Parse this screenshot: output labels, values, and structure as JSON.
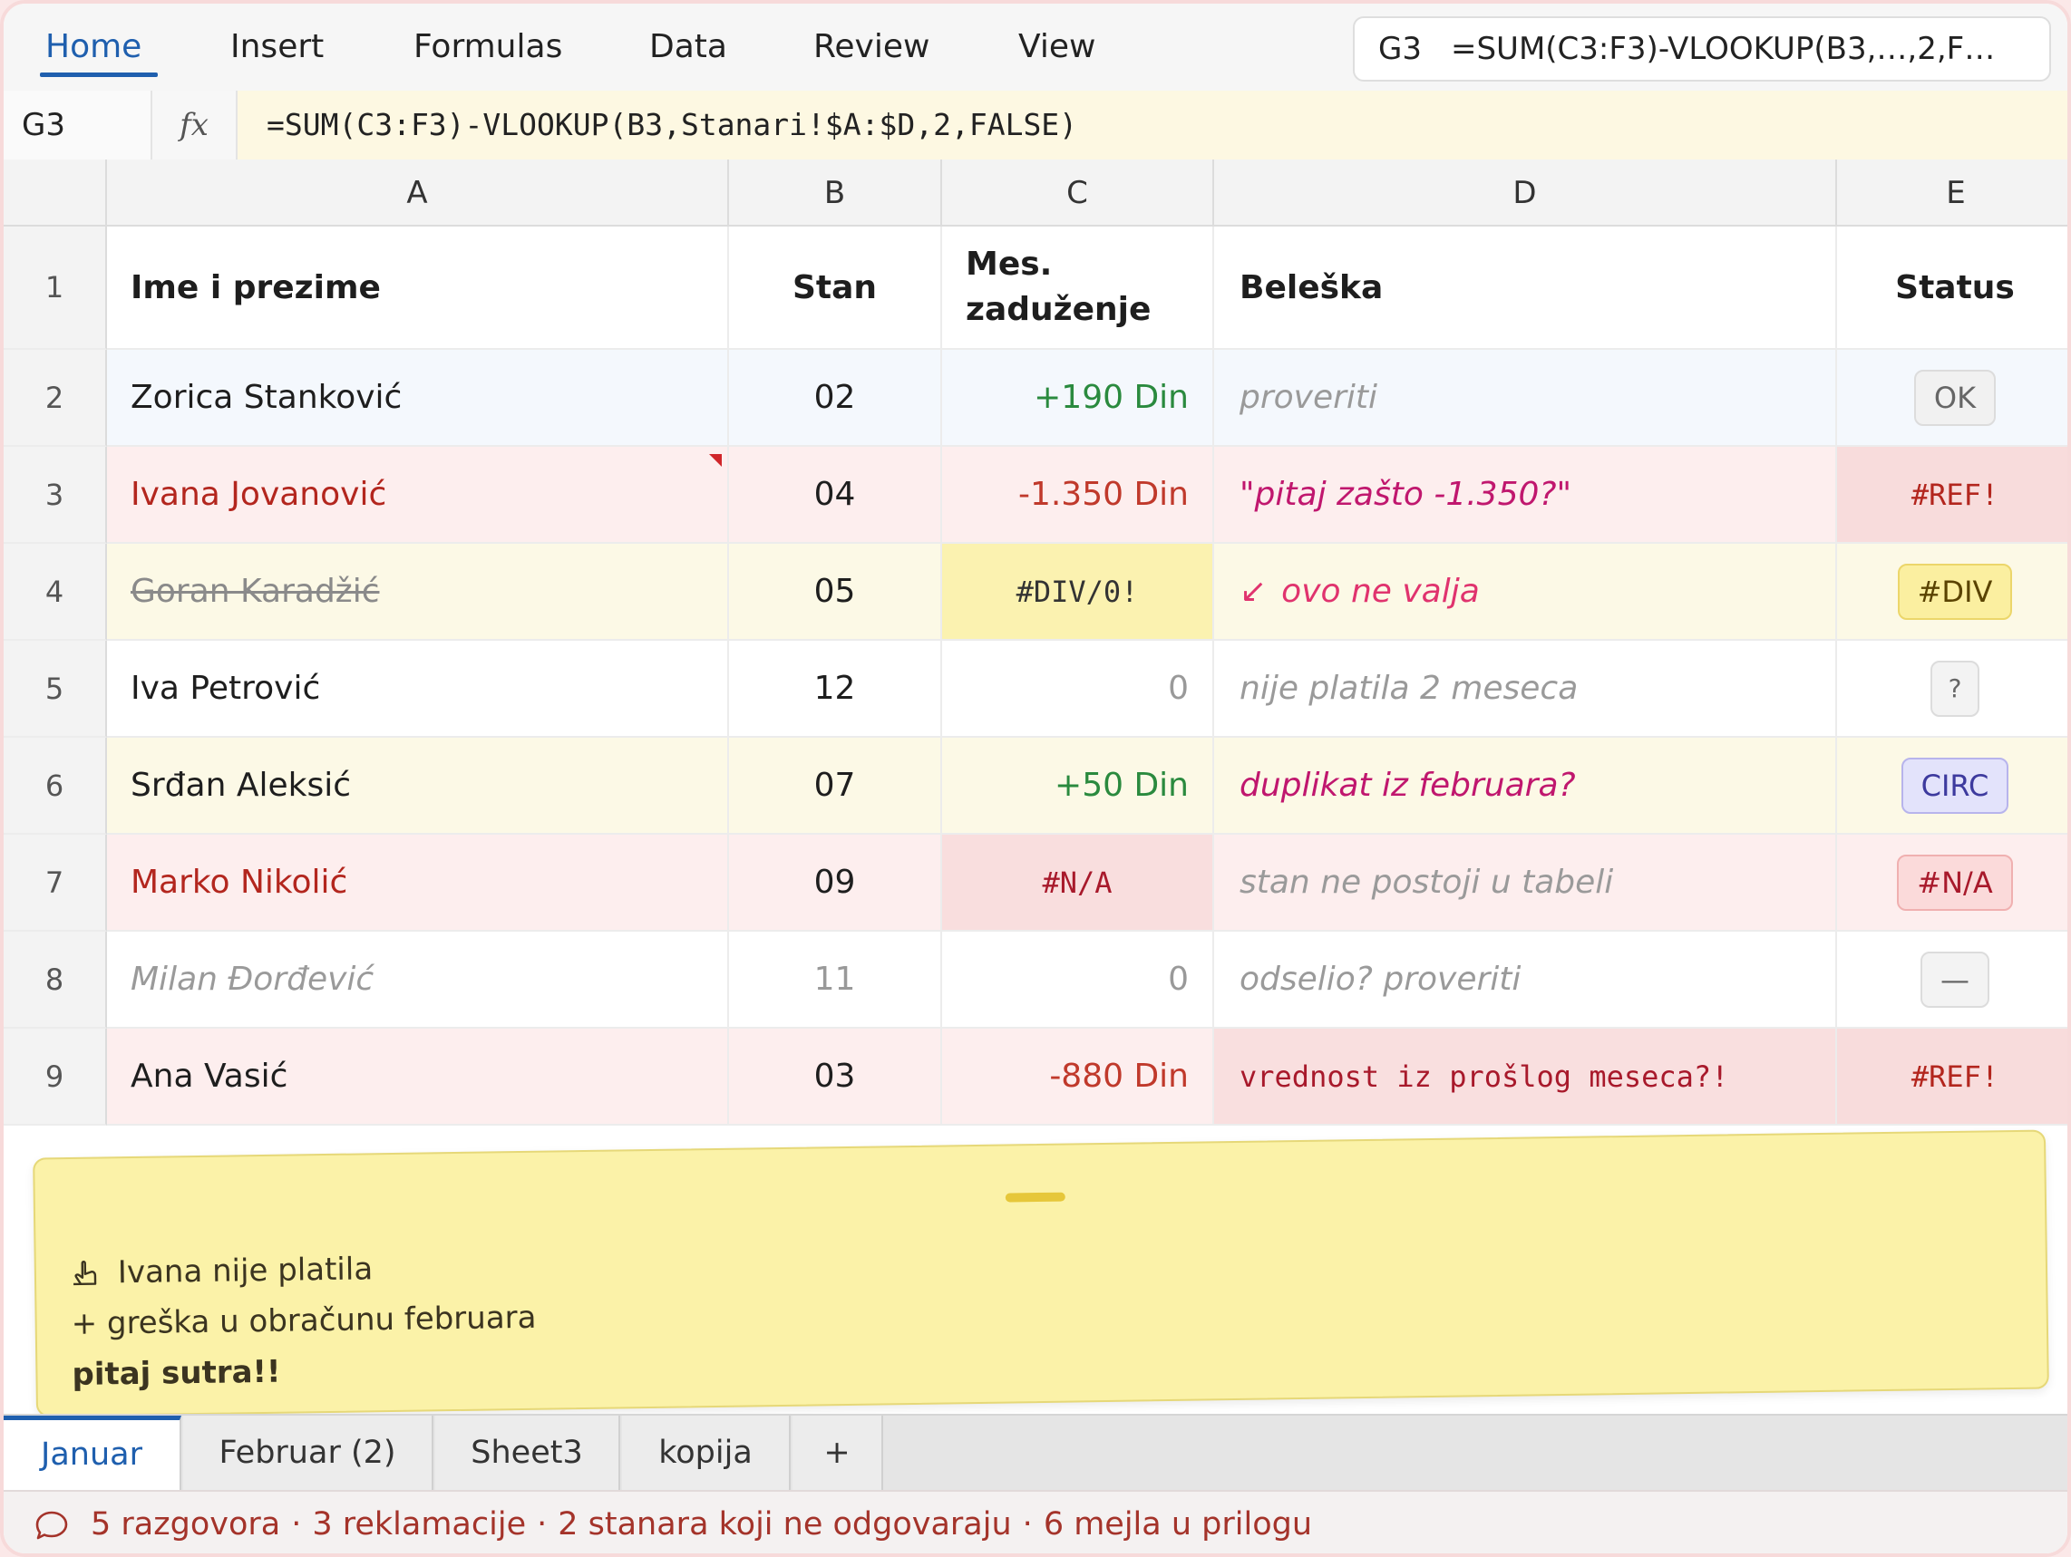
{
  "ribbon": {
    "tabs": [
      "Home",
      "Insert",
      "Formulas",
      "Data",
      "Review",
      "View"
    ],
    "active_tab": "Home",
    "name_box": {
      "ref": "G3",
      "formula": "=SUM(C3:F3)-VLOOKUP(B3,…,2,F…"
    }
  },
  "formula_bar": {
    "cell_ref": "G3",
    "fx": "fx",
    "formula": "=SUM(C3:F3)-VLOOKUP(B3,Stanari!$A:$D,2,FALSE)"
  },
  "columns": [
    "A",
    "B",
    "C",
    "D",
    "E"
  ],
  "header_row": {
    "num": "1",
    "name": "Ime i prezime",
    "stan": "Stan",
    "zaduzenje_1": "Mes.",
    "zaduzenje_2": "zaduženje",
    "beleska": "Beleška",
    "status": "Status"
  },
  "rows": [
    {
      "num": "2",
      "name": "Zorica Stanković",
      "stan": "02",
      "amount": "+190 Din",
      "note": "proveriti",
      "status": "OK"
    },
    {
      "num": "3",
      "name": "Ivana Jovanović",
      "stan": "04",
      "amount": "-1.350 Din",
      "note": "\"pitaj zašto -1.350?\"",
      "status": "#REF!"
    },
    {
      "num": "4",
      "name": "Goran Karadžić",
      "stan": "05",
      "amount": "#DIV/0!",
      "note_icon": "↙",
      "note": "ovo ne valja",
      "status": "#DIV"
    },
    {
      "num": "5",
      "name": "Iva Petrović",
      "stan": "12",
      "amount": "0",
      "note": "nije platila 2 meseca",
      "status": "?"
    },
    {
      "num": "6",
      "name": "Srđan Aleksić",
      "stan": "07",
      "amount": "+50 Din",
      "note": "duplikat iz februara?",
      "status": "CIRC"
    },
    {
      "num": "7",
      "name": "Marko Nikolić",
      "stan": "09",
      "amount": "#N/A",
      "note": "stan ne postoji u tabeli",
      "status": "#N/A"
    },
    {
      "num": "8",
      "name": "Milan Đorđević",
      "stan": "11",
      "amount": "0",
      "note": "odselio? proveriti",
      "status": "—"
    },
    {
      "num": "9",
      "name": "Ana Vasić",
      "stan": "03",
      "amount": "-880 Din",
      "note": "vrednost iz prošlog meseca?!",
      "status": "#REF!"
    }
  ],
  "sticky_note": {
    "icon": "hand-icon",
    "line1": "Ivana nije platila",
    "line2": "+ greška u obračunu februara",
    "line3": "pitaj sutra!!"
  },
  "sheet_tabs": [
    "Januar",
    "Februar (2)",
    "Sheet3",
    "kopija",
    "+"
  ],
  "status_bar": {
    "items": [
      "5 razgovora",
      "3 reklamacije",
      "2 stanara koji ne odgovaraju",
      "6 mejla u prilogu"
    ],
    "separator": "·"
  }
}
